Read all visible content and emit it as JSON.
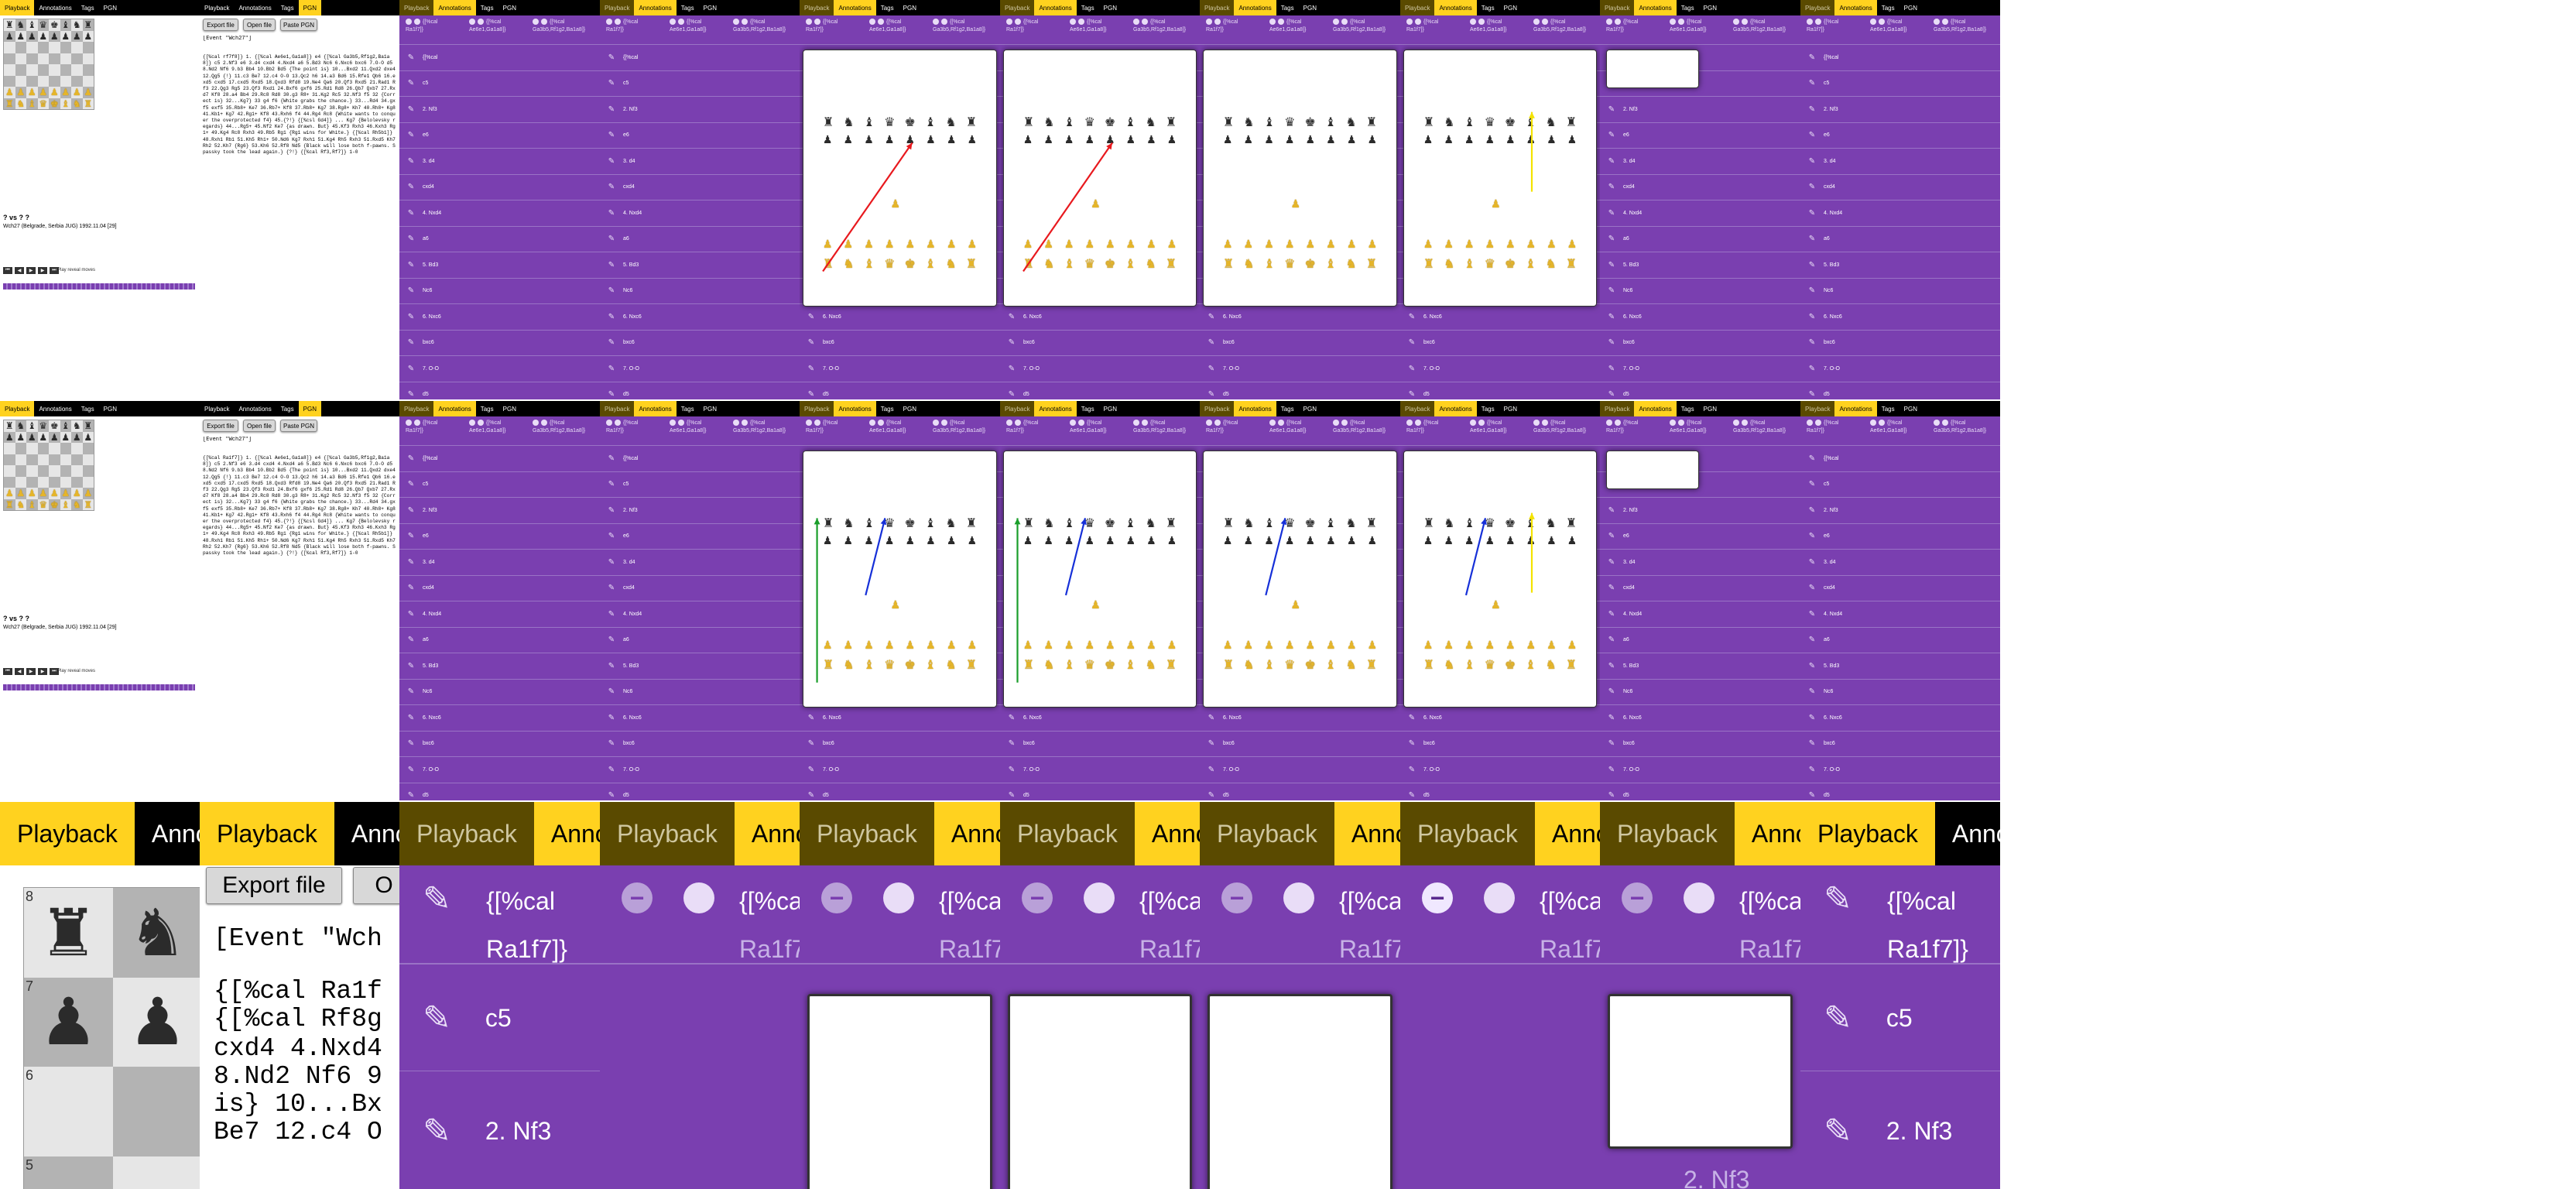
{
  "tabs": [
    "Playback",
    "Annotations",
    "Tags",
    "PGN"
  ],
  "colors": {
    "purple": "#7a3fb0",
    "yellow_tab": "#ffd21f",
    "red_arrow": "#e8191e",
    "blue_arrow": "#1630d8",
    "green_arrow": "#1a9e2a",
    "yellow_arrow": "#f4e300"
  },
  "buttons": {
    "export": "Export file",
    "open": "Open file",
    "paste": "Paste PGN"
  },
  "pgn": {
    "event": "[Event \"Wch27\"]",
    "moves_row1": "{[%cal rf7f8]} 1. {[%cal Ae6e1,Ga1a8]} e4 {[%cal Ga3b5,Rf1g2,Ba1a8]} c5 2.Nf3 e6 3.d4 cxd4 4.Nxd4 a6 5.Bd3 Nc6 6.Nxc6 bxc6 7.O-O d5 8.Nd2 Nf6 9.b3 Bb4 10.Bb2 Bd5 {The point is} 10...Bxd2 11.Qxd2 dxe4 12.Qg5 {!} 11.c3 Be7 12.c4 O-O 13.Qc2 h6 14.a3 Bd6 15.Rfe1 Qb6 16.exd5 cxd5 17.cxd5 Rxd5 18.Qxd3 Rfd8 19.Ne4 Qa6 20.Qf3 Rxd5 21.Rad1 Rf3 22.Qg3 Rg5 23.Qf3 Rxd1 24.Bxf6 gxf6 25.Rd1 Rd8 26.Qb7 Qxb7 27.Rxd7 Kf8 28.a4 Bb4 29.Rc8 Rd8 30.g3 R8+ 31.Kg2 Rc5 32.Nf3 f5 32 {Correct is} 32...Kg7} 33 g4 f6 {White grabs the chance.} 33...Rd4 34.gxf5 exf5 35.Rb8+ Ke7 36.Rb7+ Kf8 37.Rb8+ Kg7 38.Rg8+ Kh7 40.Rh8+ Kg8 41.Kb1+ Kg7 42.Rg1+ Kf8 43.Rxh6 f4 44.Rg4 Rc8 {White wants to conquer the overprotected f4} 45.{?!} {[%csl Gd4]} ... Kg7 {Belolevsky regards} 44...Rg5+ 45.Nf2 Ke7 {as drawn. But} 45.Kf3 Rxh3 46.Kxh3 Rg1+ 49.Kg4 Rc8 Rxh3 49.Rb5 Rg1 {Rg1 wins for White.} {[%cal Rh5b1]} 48.Rxh1 Rb1 51.Kh5 Rh1+ 50.Nd6 Kg7 Rxh1 51.Kg4 Rh5 Rxh3 51.Rxd5 Kh7 Rh2 52.Kh7 {Rg6} 53.Kh6 52.Rf8 Nd5 {Black will lose both f-pawns. Spassky took the lead again.} {?!} {[%cal Rf3,Rf7]} 1-0",
    "moves_row2": "{[%cal Ra1f7]} 1. {[%cal Ae6e1,Ga1a8]} e4 {[%cal Ga3b5,Rf1g2,Ba1a8]} c5 2.Nf3 e6 3.d4 cxd4 4.Nxd4 a6 5.Bd3 Nc6 6.Nxc6 bxc6 7.O-O d5 8.Nd2 Nf6 9.b3 Bb4 10.Bb2 Bd5 {The point is} 10...Bxd2 11.Qxd2 dxe4 12.Qg5 {!} 11.c3 Be7 12.c4 O-O 13.Qc2 h6 14.a3 Bd6 15.Rfe1 Qb6 16.exd5 cxd5 17.cxd5 Rxd5 18.Qxd3 Rfd8 19.Ne4 Qa6 20.Qf3 Rxd5 21.Rad1 Rf3 22.Qg3 Rg5 23.Qf3 Rxd1 24.Bxf6 gxf6 25.Rd1 Rd8 26.Qb7 Qxb7 27.Rxd7 Kf8 28.a4 Bb4 29.Rc8 Rd8 30.g3 R8+ 31.Kg2 Rc5 32.Nf3 f5 32 {Correct is} 32...Kg7} 33 g4 f6 {White grabs the chance.} 33...Rd4 34.gxf5 exf5 35.Rb8+ Ke7 36.Rb7+ Kf8 37.Rb8+ Kg7 38.Rg8+ Kh7 40.Rh8+ Kg8 41.Kb1+ Kg7 42.Rg1+ Kf8 43.Rxh6 f4 44.Rg4 Rc8 {White wants to conquer the overprotected f4} 45.{?!} {[%csl Gd4]} ... Kg7 {Belolevsky regards} 44...Rg5+ 45.Nf2 Ke7 {as drawn. But} 45.Kf3 Rxh3 46.Kxh3 Rg1+ 49.Kg4 Rc8 Rxh3 49.Rb5 Rg1 {Rg1 wins for White.} {[%cal Rh5b1]} 48.Rxh1 Rb1 51.Kh5 Rh1+ 50.Nd6 Kg7 Rxh1 51.Kg4 Rh5 Rxh3 51.Rxd5 Kh7 Rh2 52.Kh7 {Rg6} 53.Kh6 52.Rf8 Nd5 {Black will lose both f-pawns. Spassky took the lead again.} {?!} {[%cal Rf3,Rf7]} 1-0",
    "zoom_event": "[Event \"Wch",
    "zoom_lines": [
      "{[%cal Ra1f",
      "{[%cal Rf8g",
      "cxd4 4.Nxd4",
      "8.Nd2 Nf6 9",
      "is} 10...Bx",
      "Be7 12.c4 O"
    ]
  },
  "game": {
    "players": "? vs ? ?",
    "info": "Wch27 (Belgrade, Serbia JUG) 1992.11.04 [29]",
    "reveal": "Play reveal moves"
  },
  "annotations_row1": [
    "{[%cal",
    "c5",
    "2. Nf3",
    "e6",
    "3. d4",
    "cxd4",
    "4. Nxd4",
    "a6",
    "5. Bd3",
    "Nc6",
    "6. Nxc6",
    "bxc6",
    "7. O-O",
    "d5"
  ],
  "annotations_row2": [
    "{[%cal",
    "c5",
    "2. Nf3",
    "e6",
    "3. d4",
    "cxd4",
    "4. Nxd4",
    "a6",
    "5. Bd3",
    "Nc6",
    "6. Nxc6",
    "bxc6",
    "7. O-O",
    "d5"
  ],
  "annotations_header": [
    "{[%cal",
    "Ra1f7]}",
    "{[%cal",
    "Ae6e1,Ga1a8]}",
    "{[%cal",
    "Ga3b5,Rf1g2,Ba1a8]}"
  ],
  "zoom_list": {
    "first": "{[%cal",
    "first_sub": "Ra1f7]}",
    "second": "c5",
    "third": "2.  Nf3",
    "ghost": "2.  Nf3"
  },
  "zoom_board_ranks": [
    "8",
    "7",
    "6",
    "5"
  ]
}
